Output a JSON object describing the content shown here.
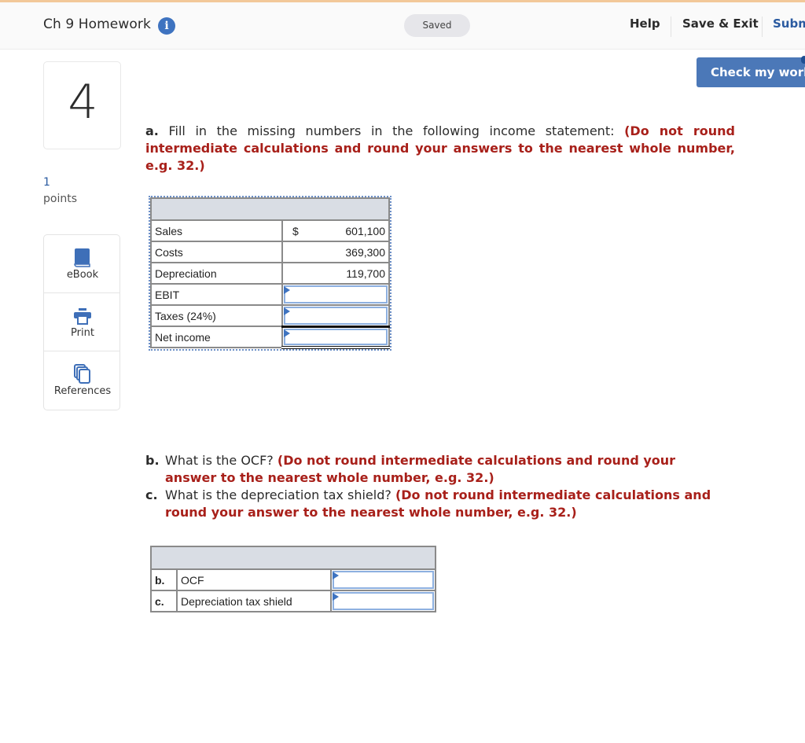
{
  "header": {
    "title": "Ch 9 Homework",
    "info_icon": "info-icon",
    "saved_label": "Saved",
    "nav": {
      "help": "Help",
      "save_exit": "Save & Exit",
      "submit": "Subm"
    },
    "accent_color": "#4b78b8",
    "top_strip_color": "#f2c899"
  },
  "check_button": "Check my work",
  "question": {
    "number": "4",
    "points_value": "1",
    "points_label": "points"
  },
  "tools": [
    {
      "label": "eBook",
      "icon": "book-icon"
    },
    {
      "label": "Print",
      "icon": "printer-icon"
    },
    {
      "label": "References",
      "icon": "copy-icon"
    }
  ],
  "part_a": {
    "label": "a.",
    "text": "Fill in the missing numbers in the following income statement:",
    "instruction": "(Do not round intermediate calculations and round your answers to the nearest whole number, e.g. 32.)"
  },
  "income_table": {
    "currency": "$",
    "rows": [
      {
        "label": "Sales",
        "value": "601,100",
        "has_currency": true
      },
      {
        "label": "Costs",
        "value": "369,300"
      },
      {
        "label": "Depreciation",
        "value": "119,700"
      },
      {
        "label": "EBIT",
        "value": "",
        "input": true
      },
      {
        "label": "Taxes (24%)",
        "value": "",
        "input": true
      },
      {
        "label": "Net income",
        "value": "",
        "input": true
      }
    ]
  },
  "part_b": {
    "label": "b.",
    "text": "What is the OCF?",
    "instruction": "(Do not round intermediate calculations and round your answer to the nearest whole number, e.g. 32.)"
  },
  "part_c": {
    "label": "c.",
    "text": "What is the depreciation tax shield?",
    "instruction": "(Do not round intermediate calculations and round your answer to the nearest whole number, e.g. 32.)"
  },
  "answer_table": {
    "rows": [
      {
        "label": "b.",
        "name": "OCF",
        "value": ""
      },
      {
        "label": "c.",
        "name": "Depreciation tax shield",
        "value": ""
      }
    ]
  }
}
